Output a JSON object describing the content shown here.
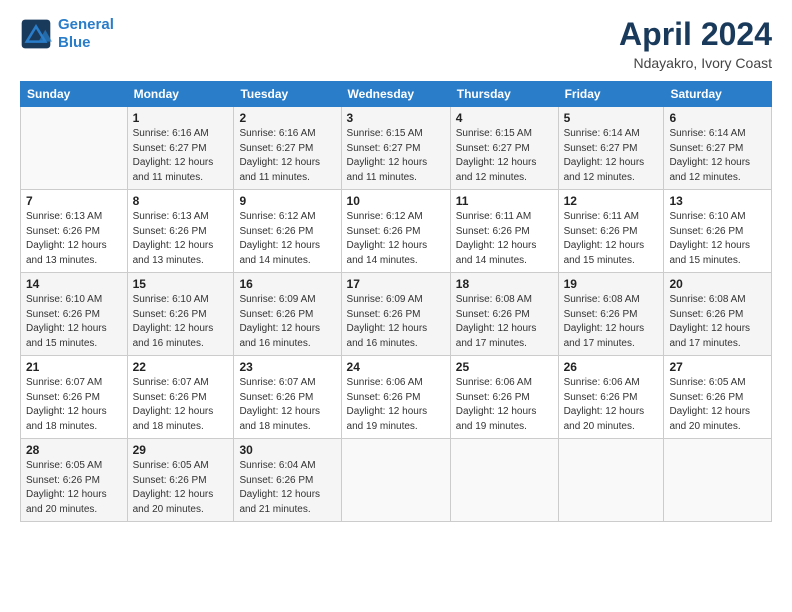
{
  "header": {
    "logo_line1": "General",
    "logo_line2": "Blue",
    "month": "April 2024",
    "location": "Ndayakro, Ivory Coast"
  },
  "weekdays": [
    "Sunday",
    "Monday",
    "Tuesday",
    "Wednesday",
    "Thursday",
    "Friday",
    "Saturday"
  ],
  "weeks": [
    [
      {
        "day": "",
        "info": ""
      },
      {
        "day": "1",
        "info": "Sunrise: 6:16 AM\nSunset: 6:27 PM\nDaylight: 12 hours\nand 11 minutes."
      },
      {
        "day": "2",
        "info": "Sunrise: 6:16 AM\nSunset: 6:27 PM\nDaylight: 12 hours\nand 11 minutes."
      },
      {
        "day": "3",
        "info": "Sunrise: 6:15 AM\nSunset: 6:27 PM\nDaylight: 12 hours\nand 11 minutes."
      },
      {
        "day": "4",
        "info": "Sunrise: 6:15 AM\nSunset: 6:27 PM\nDaylight: 12 hours\nand 12 minutes."
      },
      {
        "day": "5",
        "info": "Sunrise: 6:14 AM\nSunset: 6:27 PM\nDaylight: 12 hours\nand 12 minutes."
      },
      {
        "day": "6",
        "info": "Sunrise: 6:14 AM\nSunset: 6:27 PM\nDaylight: 12 hours\nand 12 minutes."
      }
    ],
    [
      {
        "day": "7",
        "info": "Sunrise: 6:13 AM\nSunset: 6:26 PM\nDaylight: 12 hours\nand 13 minutes."
      },
      {
        "day": "8",
        "info": "Sunrise: 6:13 AM\nSunset: 6:26 PM\nDaylight: 12 hours\nand 13 minutes."
      },
      {
        "day": "9",
        "info": "Sunrise: 6:12 AM\nSunset: 6:26 PM\nDaylight: 12 hours\nand 14 minutes."
      },
      {
        "day": "10",
        "info": "Sunrise: 6:12 AM\nSunset: 6:26 PM\nDaylight: 12 hours\nand 14 minutes."
      },
      {
        "day": "11",
        "info": "Sunrise: 6:11 AM\nSunset: 6:26 PM\nDaylight: 12 hours\nand 14 minutes."
      },
      {
        "day": "12",
        "info": "Sunrise: 6:11 AM\nSunset: 6:26 PM\nDaylight: 12 hours\nand 15 minutes."
      },
      {
        "day": "13",
        "info": "Sunrise: 6:10 AM\nSunset: 6:26 PM\nDaylight: 12 hours\nand 15 minutes."
      }
    ],
    [
      {
        "day": "14",
        "info": "Sunrise: 6:10 AM\nSunset: 6:26 PM\nDaylight: 12 hours\nand 15 minutes."
      },
      {
        "day": "15",
        "info": "Sunrise: 6:10 AM\nSunset: 6:26 PM\nDaylight: 12 hours\nand 16 minutes."
      },
      {
        "day": "16",
        "info": "Sunrise: 6:09 AM\nSunset: 6:26 PM\nDaylight: 12 hours\nand 16 minutes."
      },
      {
        "day": "17",
        "info": "Sunrise: 6:09 AM\nSunset: 6:26 PM\nDaylight: 12 hours\nand 16 minutes."
      },
      {
        "day": "18",
        "info": "Sunrise: 6:08 AM\nSunset: 6:26 PM\nDaylight: 12 hours\nand 17 minutes."
      },
      {
        "day": "19",
        "info": "Sunrise: 6:08 AM\nSunset: 6:26 PM\nDaylight: 12 hours\nand 17 minutes."
      },
      {
        "day": "20",
        "info": "Sunrise: 6:08 AM\nSunset: 6:26 PM\nDaylight: 12 hours\nand 17 minutes."
      }
    ],
    [
      {
        "day": "21",
        "info": "Sunrise: 6:07 AM\nSunset: 6:26 PM\nDaylight: 12 hours\nand 18 minutes."
      },
      {
        "day": "22",
        "info": "Sunrise: 6:07 AM\nSunset: 6:26 PM\nDaylight: 12 hours\nand 18 minutes."
      },
      {
        "day": "23",
        "info": "Sunrise: 6:07 AM\nSunset: 6:26 PM\nDaylight: 12 hours\nand 18 minutes."
      },
      {
        "day": "24",
        "info": "Sunrise: 6:06 AM\nSunset: 6:26 PM\nDaylight: 12 hours\nand 19 minutes."
      },
      {
        "day": "25",
        "info": "Sunrise: 6:06 AM\nSunset: 6:26 PM\nDaylight: 12 hours\nand 19 minutes."
      },
      {
        "day": "26",
        "info": "Sunrise: 6:06 AM\nSunset: 6:26 PM\nDaylight: 12 hours\nand 20 minutes."
      },
      {
        "day": "27",
        "info": "Sunrise: 6:05 AM\nSunset: 6:26 PM\nDaylight: 12 hours\nand 20 minutes."
      }
    ],
    [
      {
        "day": "28",
        "info": "Sunrise: 6:05 AM\nSunset: 6:26 PM\nDaylight: 12 hours\nand 20 minutes."
      },
      {
        "day": "29",
        "info": "Sunrise: 6:05 AM\nSunset: 6:26 PM\nDaylight: 12 hours\nand 20 minutes."
      },
      {
        "day": "30",
        "info": "Sunrise: 6:04 AM\nSunset: 6:26 PM\nDaylight: 12 hours\nand 21 minutes."
      },
      {
        "day": "",
        "info": ""
      },
      {
        "day": "",
        "info": ""
      },
      {
        "day": "",
        "info": ""
      },
      {
        "day": "",
        "info": ""
      }
    ]
  ]
}
